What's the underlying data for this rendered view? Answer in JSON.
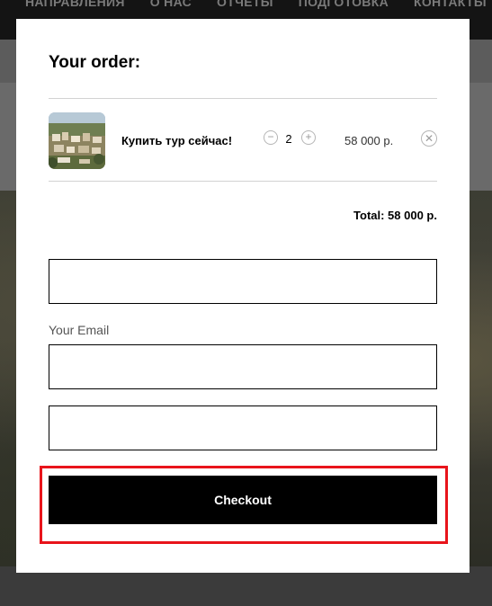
{
  "background": {
    "nav_items": [
      "НАПРАВЛЕНИЯ",
      "О НАС",
      "ОТЧЕТЫ",
      "ПОДГОТОВКА",
      "КОНТАКТЫ"
    ]
  },
  "order": {
    "title": "Your order:",
    "item": {
      "name": "Купить тур сейчас!",
      "quantity": "2",
      "price": "58 000 р.",
      "thumbnail": "town-photo"
    },
    "total": "Total: 58 000 р."
  },
  "form": {
    "email_label": "Your Email",
    "name_value": "",
    "email_value": "",
    "phone_value": ""
  },
  "checkout": {
    "label": "Checkout"
  },
  "icons": {
    "minus": "minus-circle-icon",
    "plus": "plus-circle-icon",
    "remove": "close-circle-icon"
  },
  "colors": {
    "highlight": "#e8141b",
    "button": "#000000"
  }
}
